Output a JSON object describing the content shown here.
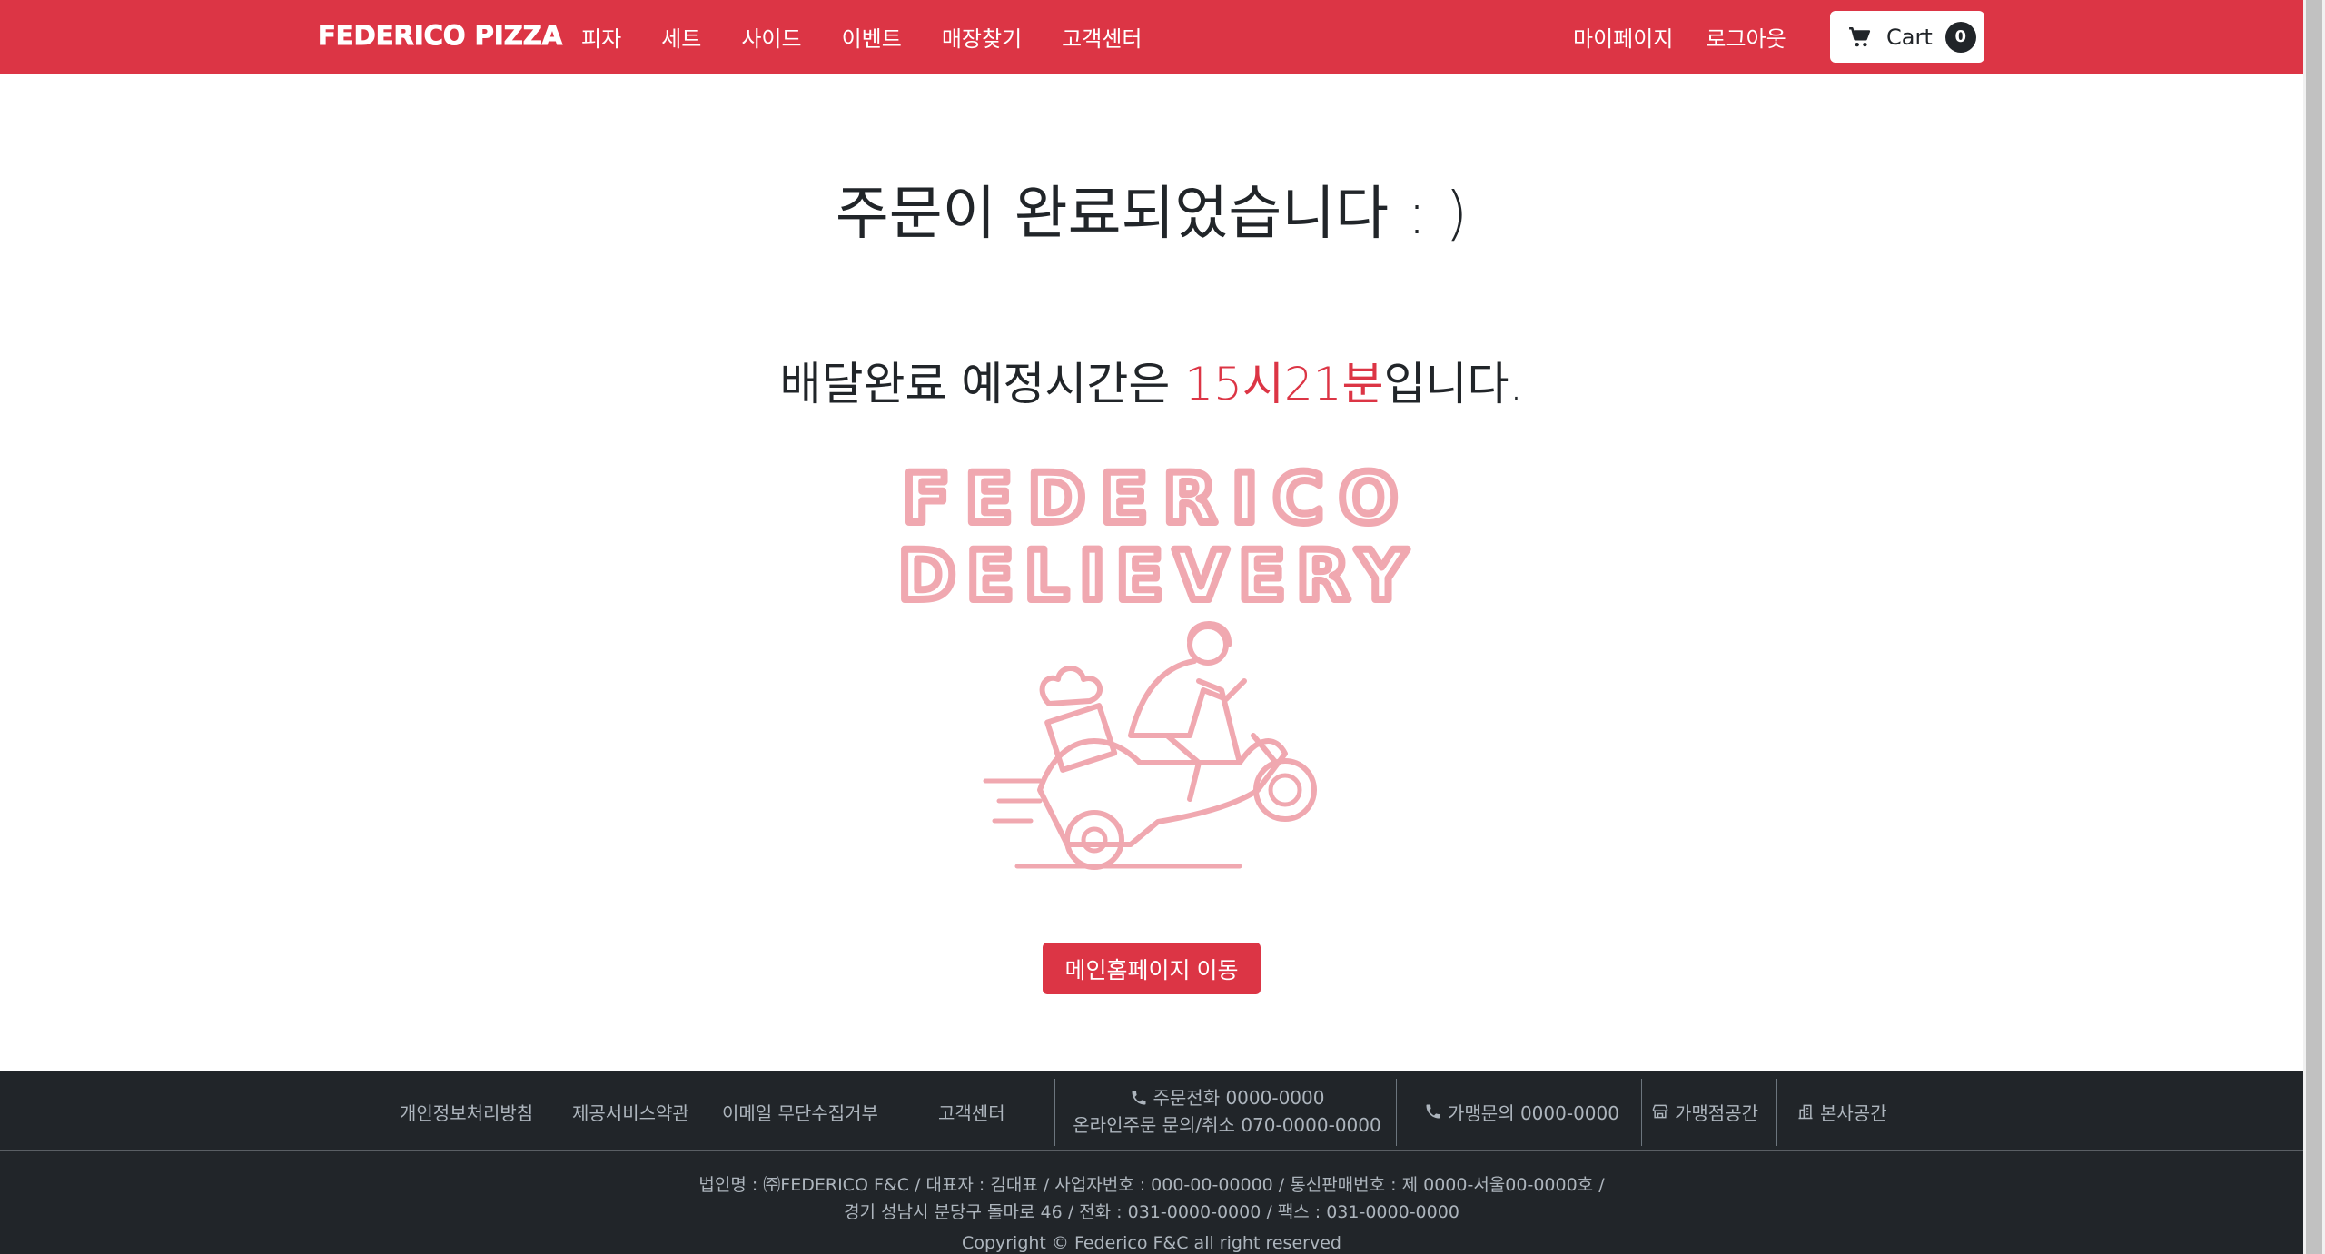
{
  "navbar": {
    "brand": "FEDERICO PIZZA",
    "menu": [
      "피자",
      "세트",
      "사이드",
      "이벤트",
      "매장찾기",
      "고객센터"
    ],
    "mypage": "마이페이지",
    "logout": "로그아웃",
    "cart_label": "Cart",
    "cart_count": "0"
  },
  "main": {
    "title": "주문이 완료되었습니다 : )",
    "eta_prefix": "배달완료 예정시간은 ",
    "eta_time": "15시21분",
    "eta_suffix": "입니다.",
    "logo_line1": "FEDERICO",
    "logo_line2": "DELIEVERY",
    "home_button": "메인홈페이지 이동"
  },
  "footer": {
    "links": [
      "개인정보처리방침",
      "제공서비스약관",
      "이메일 무단수집거부",
      "고객센터"
    ],
    "order_phone": "주문전화 0000-0000",
    "online_inquiry": "온라인주문 문의/취소 070-0000-0000",
    "franchise_phone": "가맹문의 0000-0000",
    "franchise_notice": "가맹점공간",
    "hq_notice": "본사공간",
    "info_line1": "법인명 : ㈜FEDERICO F&C / 대표자 : 김대표 / 사업자번호 : 000-00-00000 / 통신판매번호 : 제 0000-서울00-0000호 /",
    "info_line2": "경기 성남시 분당구 돌마로 46 / 전화 : 031-0000-0000 / 팩스 : 031-0000-0000",
    "copyright": "Copyright © Federico F&C all right reserved"
  },
  "colors": {
    "brand_red": "#dc3545",
    "footer_bg": "#212529",
    "illustration_pink": "#f0a8b0"
  }
}
